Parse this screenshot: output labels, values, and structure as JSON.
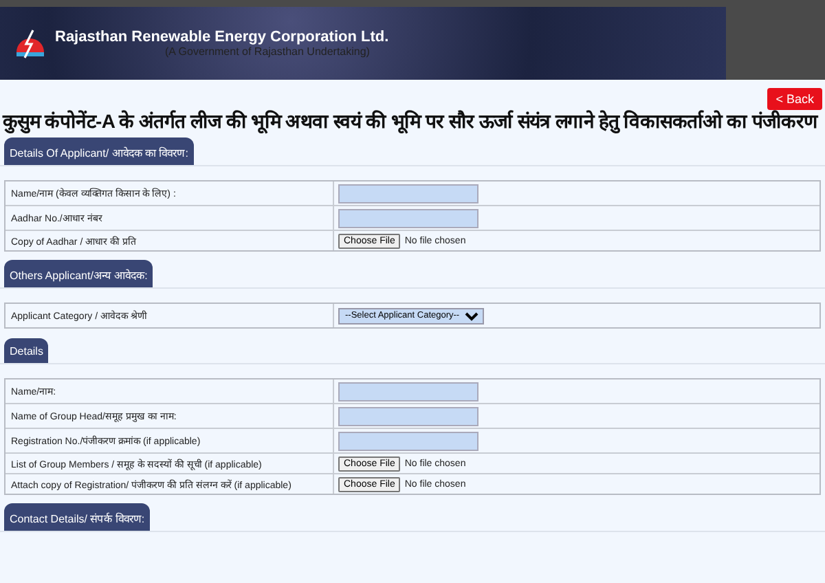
{
  "header": {
    "title": "Rajasthan Renewable Energy Corporation Ltd.",
    "subtitle": "(A Government of Rajasthan Undertaking)"
  },
  "back_button": "< Back",
  "page_title": "कुसुम कंपोनेंट-A के अंतर्गत लीज की भूमि अथवा स्वयं की भूमि पर सौर ऊर्जा संयंत्र लगाने हेतु विकासकर्ताओ का पंजीकरण",
  "sections": [
    {
      "heading": "Details Of Applicant/ आवेदक का विवरण:",
      "rows": [
        {
          "kind": "text",
          "label": "Name/नाम (केवल व्यक्तिगत किसान के लिए) :"
        },
        {
          "kind": "text",
          "label": "Aadhar No./आधार नंबर"
        },
        {
          "kind": "file",
          "label": "Copy of Aadhar / आधार की प्रति",
          "button": "Choose File",
          "status": "No file chosen"
        }
      ]
    },
    {
      "heading": "Others Applicant/अन्य आवेदक:",
      "rows": [
        {
          "kind": "select",
          "label": "Applicant Category / आवेदक श्रेणी",
          "value": "--Select Applicant Category--"
        }
      ]
    },
    {
      "heading": "Details",
      "rows": [
        {
          "kind": "text",
          "label": "Name/नाम:"
        },
        {
          "kind": "text",
          "label": "Name of Group Head/समूह प्रमुख का नाम:"
        },
        {
          "kind": "text",
          "label": "Registration No./पंजीकरण क्रमांक (if applicable)"
        },
        {
          "kind": "file",
          "label": "List of Group Members / समूह के सदस्यों की सूची (if applicable)",
          "button": "Choose File",
          "status": "No file chosen"
        },
        {
          "kind": "file",
          "label": "Attach copy of Registration/ पंजीकरण की प्रति संलग्न करें (if applicable)",
          "button": "Choose File",
          "status": "No file chosen"
        }
      ]
    },
    {
      "heading": "Contact Details/ संपर्क विवरण:"
    }
  ]
}
